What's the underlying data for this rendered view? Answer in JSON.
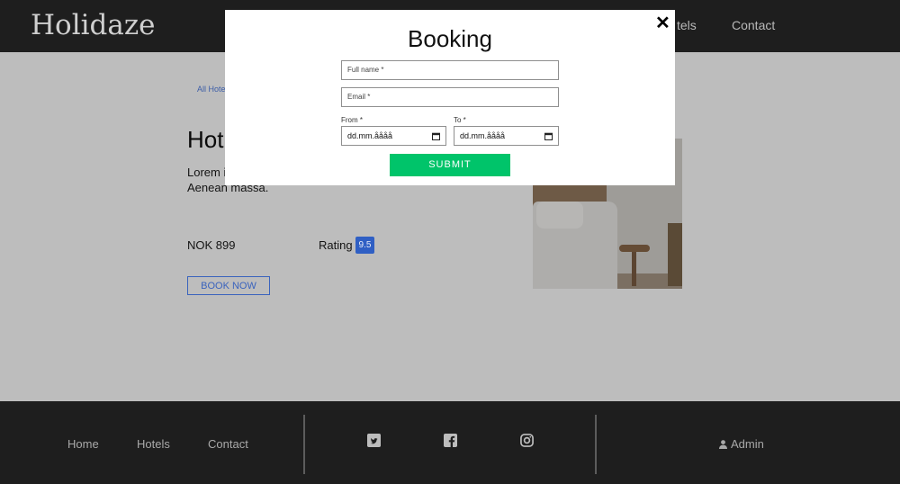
{
  "header": {
    "logo": "Holidaze",
    "nav": {
      "hotels": "tels",
      "contact": "Contact"
    }
  },
  "main": {
    "breadcrumb": "All Hotel",
    "title": "Hot",
    "description": "Lorem i elit. Aenean commodo ligula eget dolor. Aenean massa.",
    "price": "NOK 899",
    "rating_label": "Rating",
    "rating_value": "9.5",
    "book_now": "BOOK NOW"
  },
  "footer": {
    "links": {
      "home": "Home",
      "hotels": "Hotels",
      "contact": "Contact"
    },
    "admin": "Admin",
    "social_icons": [
      "twitter-icon",
      "facebook-icon",
      "instagram-icon"
    ]
  },
  "modal": {
    "close": "✕",
    "title": "Booking",
    "full_name_placeholder": "Full name *",
    "email_placeholder": "Email *",
    "from_label": "From *",
    "to_label": "To *",
    "from_value": "dd.mm.åååå",
    "to_value": "dd.mm.åååå",
    "submit": "SUBMIT"
  },
  "colors": {
    "header_bg": "#1e1e1e",
    "accent_blue": "#3a63bd",
    "submit_green": "#00c46a",
    "overlay_bg": "#bdbdbd"
  }
}
